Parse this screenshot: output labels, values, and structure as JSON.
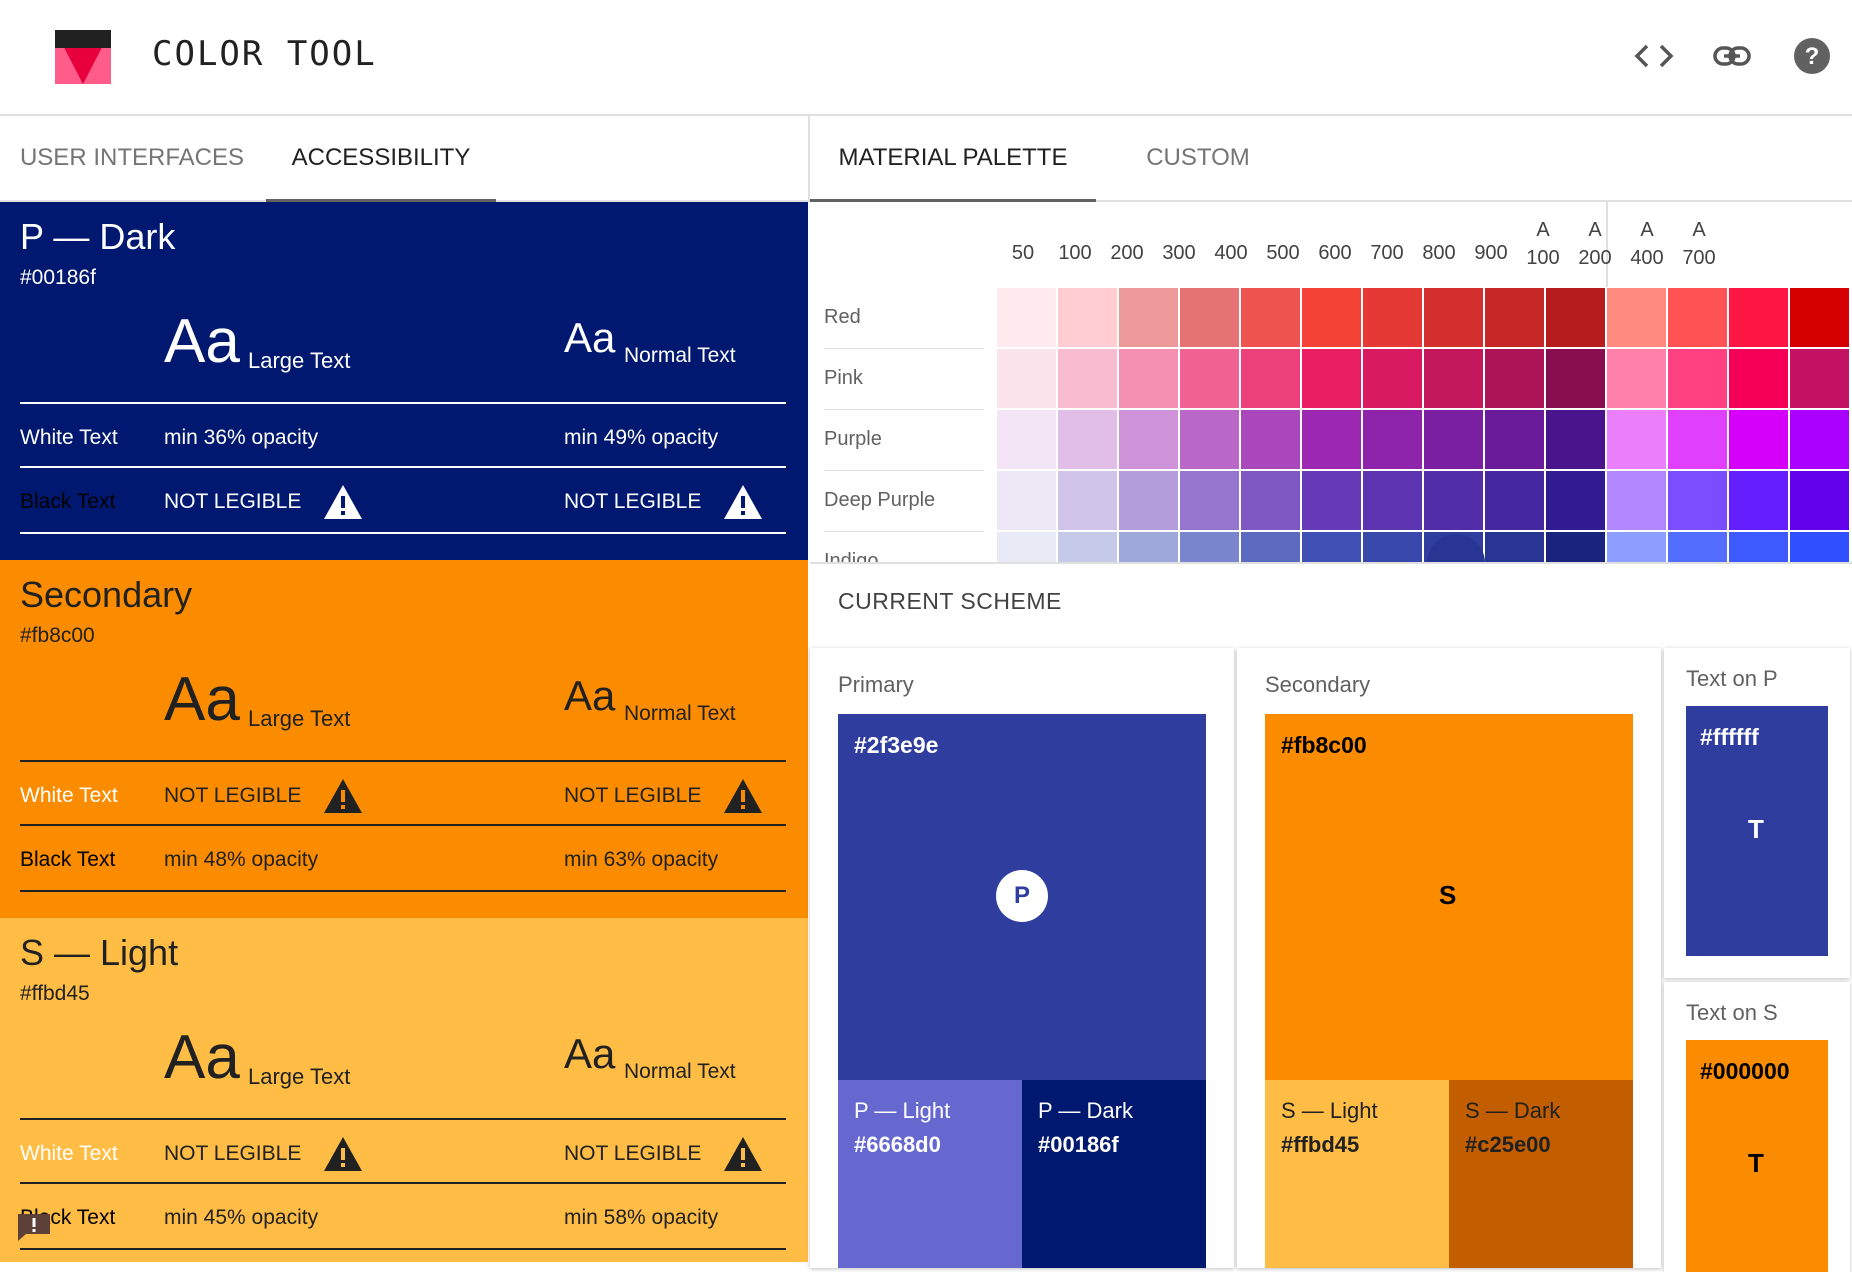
{
  "header": {
    "title": "COLOR TOOL",
    "icons": [
      "code-icon",
      "link-icon",
      "help-icon"
    ]
  },
  "left_tabs": [
    {
      "label": "USER INTERFACES",
      "active": false
    },
    {
      "label": "ACCESSIBILITY",
      "active": true
    }
  ],
  "panels": [
    {
      "title": "P — Dark",
      "hex": "#00186f",
      "bg": "#00186f",
      "fg": "#ffffff",
      "large_text": "Large Text",
      "normal_text": "Normal Text",
      "aa": "Aa",
      "white_row": {
        "label": "White Text",
        "large": "min 36% opacity",
        "normal": "min 49% opacity",
        "large_warn": false,
        "normal_warn": false
      },
      "black_row": {
        "label": "Black Text",
        "large": "NOT LEGIBLE",
        "normal": "NOT LEGIBLE",
        "large_warn": true,
        "normal_warn": true
      }
    },
    {
      "title": "Secondary",
      "hex": "#fb8c00",
      "bg": "#fb8c00",
      "fg": "#212121",
      "large_text": "Large Text",
      "normal_text": "Normal Text",
      "aa": "Aa",
      "white_row": {
        "label": "White Text",
        "large": "NOT LEGIBLE",
        "normal": "NOT LEGIBLE",
        "large_warn": true,
        "normal_warn": true
      },
      "black_row": {
        "label": "Black Text",
        "large": "min 48% opacity",
        "normal": "min 63% opacity",
        "large_warn": false,
        "normal_warn": false
      }
    },
    {
      "title": "S — Light",
      "hex": "#ffbd45",
      "bg": "#ffbd45",
      "fg": "#212121",
      "large_text": "Large Text",
      "normal_text": "Normal Text",
      "aa": "Aa",
      "white_row": {
        "label": "White Text",
        "large": "NOT LEGIBLE",
        "normal": "NOT LEGIBLE",
        "large_warn": true,
        "normal_warn": true
      },
      "black_row": {
        "label": "Black Text",
        "large": "min 45% opacity",
        "normal": "min 58% opacity",
        "large_warn": false,
        "normal_warn": false
      }
    }
  ],
  "right_tabs": [
    {
      "label": "MATERIAL PALETTE",
      "active": true
    },
    {
      "label": "CUSTOM",
      "active": false
    }
  ],
  "palette": {
    "shades": [
      "50",
      "100",
      "200",
      "300",
      "400",
      "500",
      "600",
      "700",
      "800",
      "900"
    ],
    "accents": [
      [
        "A",
        "100"
      ],
      [
        "A",
        "200"
      ],
      [
        "A",
        "400"
      ],
      [
        "A",
        "700"
      ]
    ],
    "colors": [
      {
        "name": "Red",
        "swatches": [
          "#ffebee",
          "#ffcdd2",
          "#ef9a9a",
          "#e57373",
          "#ef5350",
          "#f44336",
          "#e53935",
          "#d32f2f",
          "#c62828",
          "#b71c1c",
          "#ff8a80",
          "#ff5252",
          "#ff1744",
          "#d50000"
        ]
      },
      {
        "name": "Pink",
        "swatches": [
          "#fce4ec",
          "#f8bbd0",
          "#f48fb1",
          "#f06292",
          "#ec407a",
          "#e91e63",
          "#d81b60",
          "#c2185b",
          "#ad1457",
          "#880e4f",
          "#ff80ab",
          "#ff4081",
          "#f50057",
          "#c51162"
        ]
      },
      {
        "name": "Purple",
        "swatches": [
          "#f3e5f5",
          "#e1bee7",
          "#ce93d8",
          "#ba68c8",
          "#ab47bc",
          "#9c27b0",
          "#8e24aa",
          "#7b1fa2",
          "#6a1b9a",
          "#4a148c",
          "#ea80fc",
          "#e040fb",
          "#d500f9",
          "#aa00ff"
        ]
      },
      {
        "name": "Deep Purple",
        "swatches": [
          "#ede7f6",
          "#d1c4e9",
          "#b39ddb",
          "#9575cd",
          "#7e57c2",
          "#673ab7",
          "#5e35b1",
          "#512da8",
          "#4527a0",
          "#311b92",
          "#b388ff",
          "#7c4dff",
          "#651fff",
          "#6200ea"
        ]
      },
      {
        "name": "Indigo",
        "swatches": [
          "#e8eaf6",
          "#c5cae9",
          "#9fa8da",
          "#7986cb",
          "#5c6bc0",
          "#3f51b5",
          "#3949ab",
          "#303f9f",
          "#283593",
          "#1a237e",
          "#8c9eff",
          "#536dfe",
          "#3d5afe",
          "#304ffe"
        ]
      }
    ]
  },
  "scheme": {
    "title": "CURRENT SCHEME",
    "primary": {
      "label": "Primary",
      "hex": "#2f3e9e",
      "letter": "P",
      "light": {
        "title": "P — Light",
        "hex": "#6668d0"
      },
      "dark": {
        "title": "P — Dark",
        "hex": "#00186f"
      }
    },
    "secondary": {
      "label": "Secondary",
      "hex": "#fb8c00",
      "letter": "S",
      "light": {
        "title": "S — Light",
        "hex": "#ffbd45"
      },
      "dark": {
        "title": "S — Dark",
        "hex": "#c25e00"
      }
    },
    "text_on_p": {
      "label": "Text on P",
      "hex": "#ffffff",
      "letter": "T",
      "bg": "#2f3e9e"
    },
    "text_on_s": {
      "label": "Text on S",
      "hex": "#000000",
      "letter": "T",
      "bg": "#fb8c00"
    }
  }
}
